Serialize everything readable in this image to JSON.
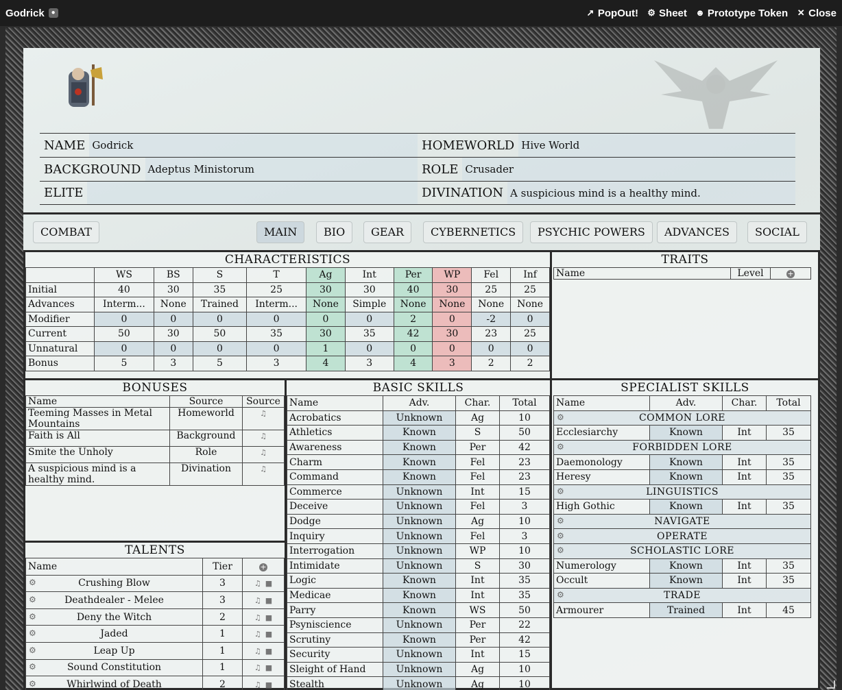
{
  "window": {
    "title": "Godrick",
    "actions": {
      "popout": "PopOut!",
      "sheet": "Sheet",
      "token": "Prototype Token",
      "close": "Close"
    }
  },
  "header": {
    "name_label": "NAME",
    "name": "Godrick",
    "homeworld_label": "HOMEWORLD",
    "homeworld": "Hive World",
    "background_label": "BACKGROUND",
    "background": "Adeptus Ministorum",
    "role_label": "ROLE",
    "role": "Crusader",
    "elite_label": "ELITE",
    "elite": "",
    "divination_label": "DIVINATION",
    "divination": "A suspicious mind is a healthy mind."
  },
  "tabs": {
    "combat": "COMBAT",
    "main": "MAIN",
    "bio": "BIO",
    "gear": "GEAR",
    "cybernetics": "CYBERNETICS",
    "psychic": "PSYCHIC POWERS",
    "advances": "ADVANCES",
    "social": "SOCIAL"
  },
  "characteristics": {
    "title": "CHARACTERISTICS",
    "cols": [
      "WS",
      "BS",
      "S",
      "T",
      "Ag",
      "Int",
      "Per",
      "WP",
      "Fel",
      "Inf"
    ],
    "rows": [
      {
        "label": "Initial",
        "values": [
          "40",
          "30",
          "35",
          "25",
          "30",
          "30",
          "40",
          "30",
          "25",
          "25"
        ]
      },
      {
        "label": "Advances",
        "values": [
          "Interm...",
          "None",
          "Trained",
          "Interm...",
          "None",
          "Simple",
          "None",
          "None",
          "None",
          "None"
        ]
      },
      {
        "label": "Modifier",
        "values": [
          "0",
          "0",
          "0",
          "0",
          "0",
          "0",
          "2",
          "0",
          "-2",
          "0"
        ]
      },
      {
        "label": "Current",
        "values": [
          "50",
          "30",
          "50",
          "35",
          "30",
          "35",
          "42",
          "30",
          "23",
          "25"
        ]
      },
      {
        "label": "Unnatural",
        "values": [
          "0",
          "0",
          "0",
          "0",
          "1",
          "0",
          "0",
          "0",
          "0",
          "0"
        ]
      },
      {
        "label": "Bonus",
        "values": [
          "5",
          "3",
          "5",
          "3",
          "4",
          "3",
          "4",
          "3",
          "2",
          "2"
        ]
      }
    ]
  },
  "traits": {
    "title": "TRAITS",
    "col_name": "Name",
    "col_level": "Level"
  },
  "bonuses": {
    "title": "BONUSES",
    "col_name": "Name",
    "col_source": "Source",
    "col_source2": "Source",
    "rows": [
      {
        "name": "Teeming Masses in Metal Mountains",
        "source": "Homeworld"
      },
      {
        "name": "Faith is All",
        "source": "Background"
      },
      {
        "name": "Smite the Unholy",
        "source": "Role"
      },
      {
        "name": "A suspicious mind is a healthy mind.",
        "source": "Divination"
      }
    ]
  },
  "talents": {
    "title": "TALENTS",
    "col_name": "Name",
    "col_tier": "Tier",
    "rows": [
      {
        "name": "Crushing Blow",
        "tier": "3"
      },
      {
        "name": "Deathdealer - Melee",
        "tier": "3"
      },
      {
        "name": "Deny the Witch",
        "tier": "2"
      },
      {
        "name": "Jaded",
        "tier": "1"
      },
      {
        "name": "Leap Up",
        "tier": "1"
      },
      {
        "name": "Sound Constitution",
        "tier": "1"
      },
      {
        "name": "Whirlwind of Death",
        "tier": "2"
      }
    ]
  },
  "basic_skills": {
    "title": "BASIC SKILLS",
    "col_name": "Name",
    "col_adv": "Adv.",
    "col_char": "Char.",
    "col_total": "Total",
    "rows": [
      [
        "Acrobatics",
        "Unknown",
        "Ag",
        "10"
      ],
      [
        "Athletics",
        "Known",
        "S",
        "50"
      ],
      [
        "Awareness",
        "Known",
        "Per",
        "42"
      ],
      [
        "Charm",
        "Known",
        "Fel",
        "23"
      ],
      [
        "Command",
        "Known",
        "Fel",
        "23"
      ],
      [
        "Commerce",
        "Unknown",
        "Int",
        "15"
      ],
      [
        "Deceive",
        "Unknown",
        "Fel",
        "3"
      ],
      [
        "Dodge",
        "Unknown",
        "Ag",
        "10"
      ],
      [
        "Inquiry",
        "Unknown",
        "Fel",
        "3"
      ],
      [
        "Interrogation",
        "Unknown",
        "WP",
        "10"
      ],
      [
        "Intimidate",
        "Unknown",
        "S",
        "30"
      ],
      [
        "Logic",
        "Known",
        "Int",
        "35"
      ],
      [
        "Medicae",
        "Known",
        "Int",
        "35"
      ],
      [
        "Parry",
        "Known",
        "WS",
        "50"
      ],
      [
        "Psyniscience",
        "Unknown",
        "Per",
        "22"
      ],
      [
        "Scrutiny",
        "Known",
        "Per",
        "42"
      ],
      [
        "Security",
        "Unknown",
        "Int",
        "15"
      ],
      [
        "Sleight of Hand",
        "Unknown",
        "Ag",
        "10"
      ],
      [
        "Stealth",
        "Unknown",
        "Ag",
        "10"
      ]
    ]
  },
  "specialist_skills": {
    "title": "SPECIALIST SKILLS",
    "col_name": "Name",
    "col_adv": "Adv.",
    "col_char": "Char.",
    "col_total": "Total",
    "groups": [
      {
        "name": "COMMON LORE",
        "rows": [
          [
            "Ecclesiarchy",
            "Known",
            "Int",
            "35"
          ]
        ]
      },
      {
        "name": "FORBIDDEN LORE",
        "rows": [
          [
            "Daemonology",
            "Known",
            "Int",
            "35"
          ],
          [
            "Heresy",
            "Known",
            "Int",
            "35"
          ]
        ]
      },
      {
        "name": "LINGUISTICS",
        "rows": [
          [
            "High Gothic",
            "Known",
            "Int",
            "35"
          ]
        ]
      },
      {
        "name": "NAVIGATE",
        "rows": []
      },
      {
        "name": "OPERATE",
        "rows": []
      },
      {
        "name": "SCHOLASTIC LORE",
        "rows": [
          [
            "Numerology",
            "Known",
            "Int",
            "35"
          ],
          [
            "Occult",
            "Known",
            "Int",
            "35"
          ]
        ]
      },
      {
        "name": "TRADE",
        "rows": [
          [
            "Armourer",
            "Trained",
            "Int",
            "45"
          ]
        ]
      }
    ]
  },
  "icons": {
    "gear": "gear-icon",
    "speaker": "speaker-icon",
    "trash": "trash-icon",
    "add": "add-icon"
  }
}
